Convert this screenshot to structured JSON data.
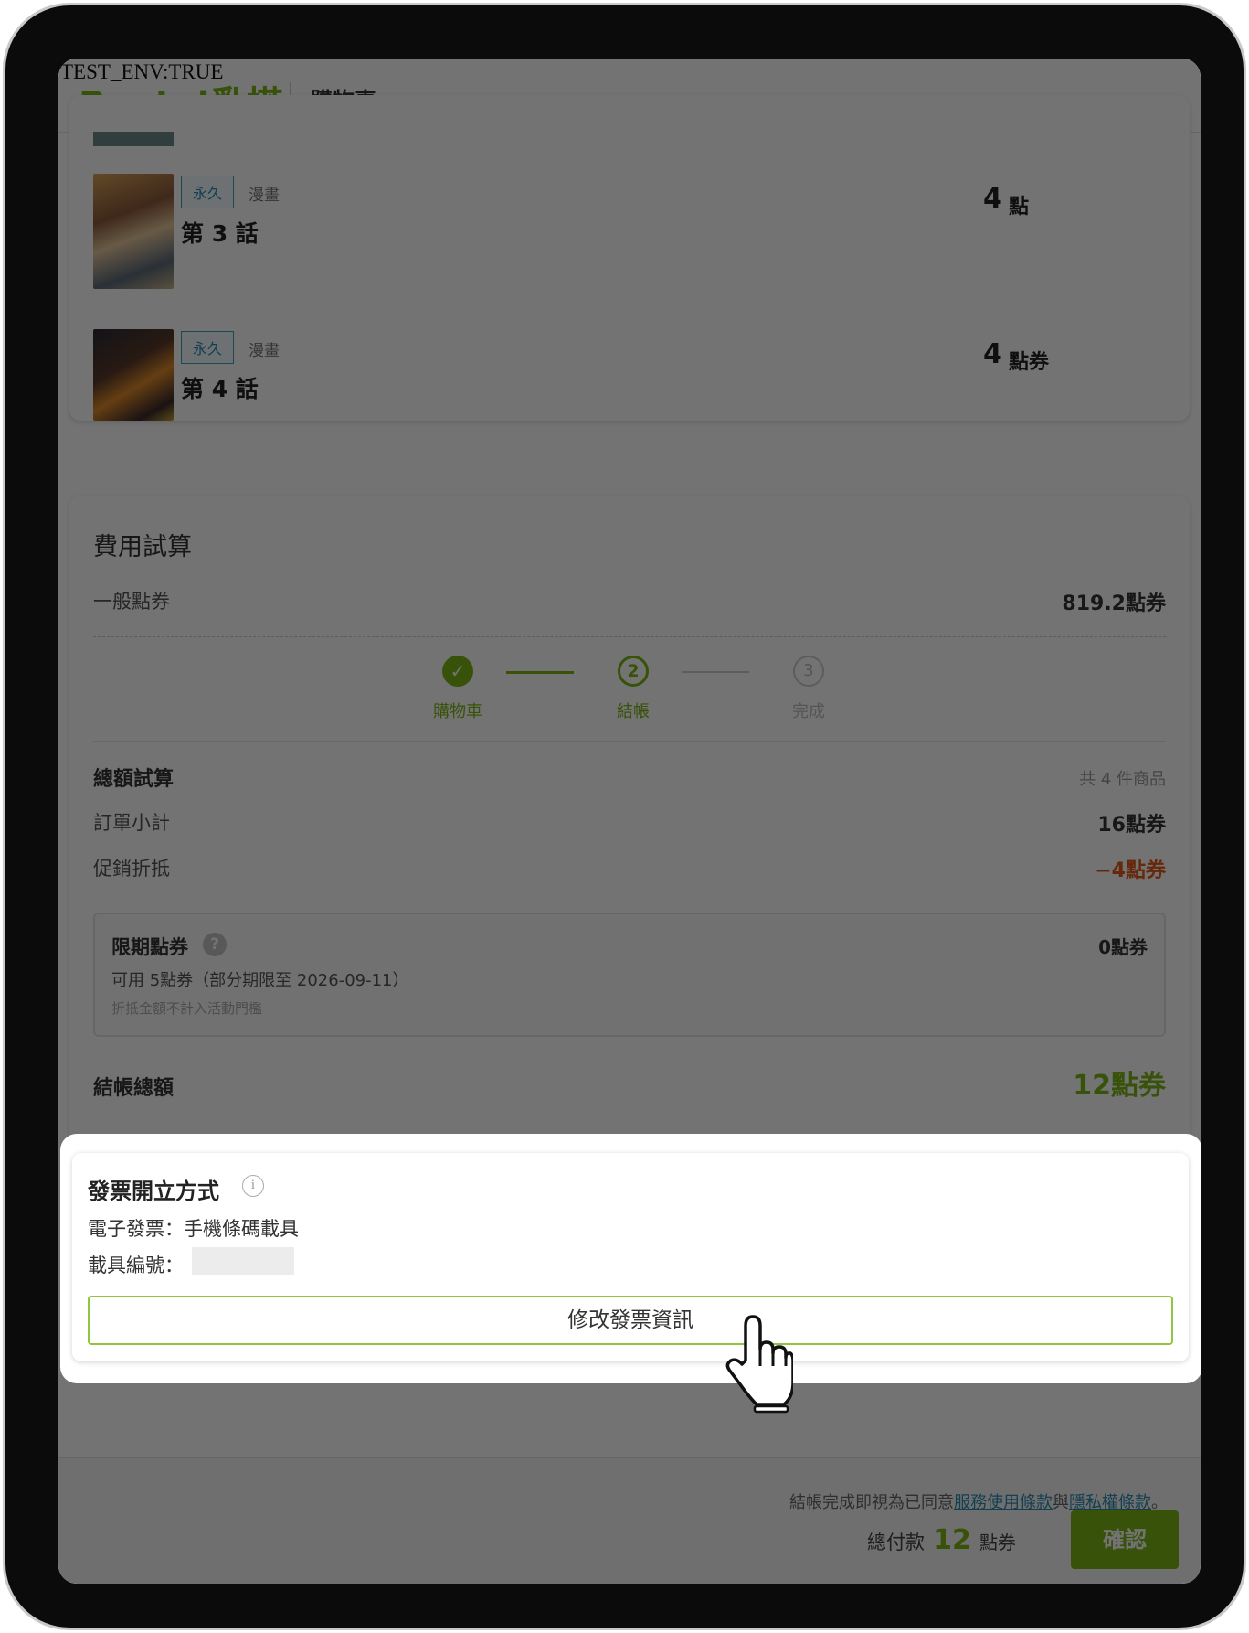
{
  "debug": {
    "env_flag": "TEST_ENV:TRUE"
  },
  "header": {
    "logo": "Renta!亂搭",
    "title": "購物車"
  },
  "cart_items": [
    {
      "tag": "永久",
      "category": "漫畫",
      "episode": "第 3 話",
      "price_num": "4",
      "price_unit": "點"
    },
    {
      "tag": "永久",
      "category": "漫畫",
      "episode": "第 4 話",
      "price_num": "4",
      "price_unit": "點券"
    }
  ],
  "fees": {
    "title": "費用試算",
    "general_label": "一般點券",
    "general_value": "819.2點券"
  },
  "steps": [
    {
      "num": "✓",
      "label": "購物車"
    },
    {
      "num": "2",
      "label": "結帳"
    },
    {
      "num": "3",
      "label": "完成"
    }
  ],
  "summary": {
    "title": "總額試算",
    "count": "共 4 件商品",
    "subtotal_label": "訂單小計",
    "subtotal_value": "16點券",
    "discount_label": "促銷折抵",
    "discount_value": "−4點券",
    "limited_label": "限期點券",
    "limited_value": "0點券",
    "limited_avail": "可用 5點券（部分期限至 2026-09-11）",
    "limited_note": "折抵金額不計入活動門檻",
    "total_label": "結帳總額",
    "total_value": "12點券"
  },
  "invoice": {
    "title": "發票開立方式",
    "type": "電子發票：手機條碼載具",
    "carrier_label": "載具編號：",
    "edit_button": "修改發票資訊"
  },
  "footer": {
    "terms_prefix": "結帳完成即視為已同意",
    "terms_link": "服務使用條款",
    "terms_and": "與",
    "privacy_link": "隱私權條款",
    "terms_suffix": "。",
    "total_label": "總付款",
    "total_num": "12",
    "total_unit": "點券",
    "confirm": "確認"
  },
  "colors": {
    "accent": "#7cb518",
    "discount": "#e05a1a",
    "tag": "#2b8db3"
  }
}
